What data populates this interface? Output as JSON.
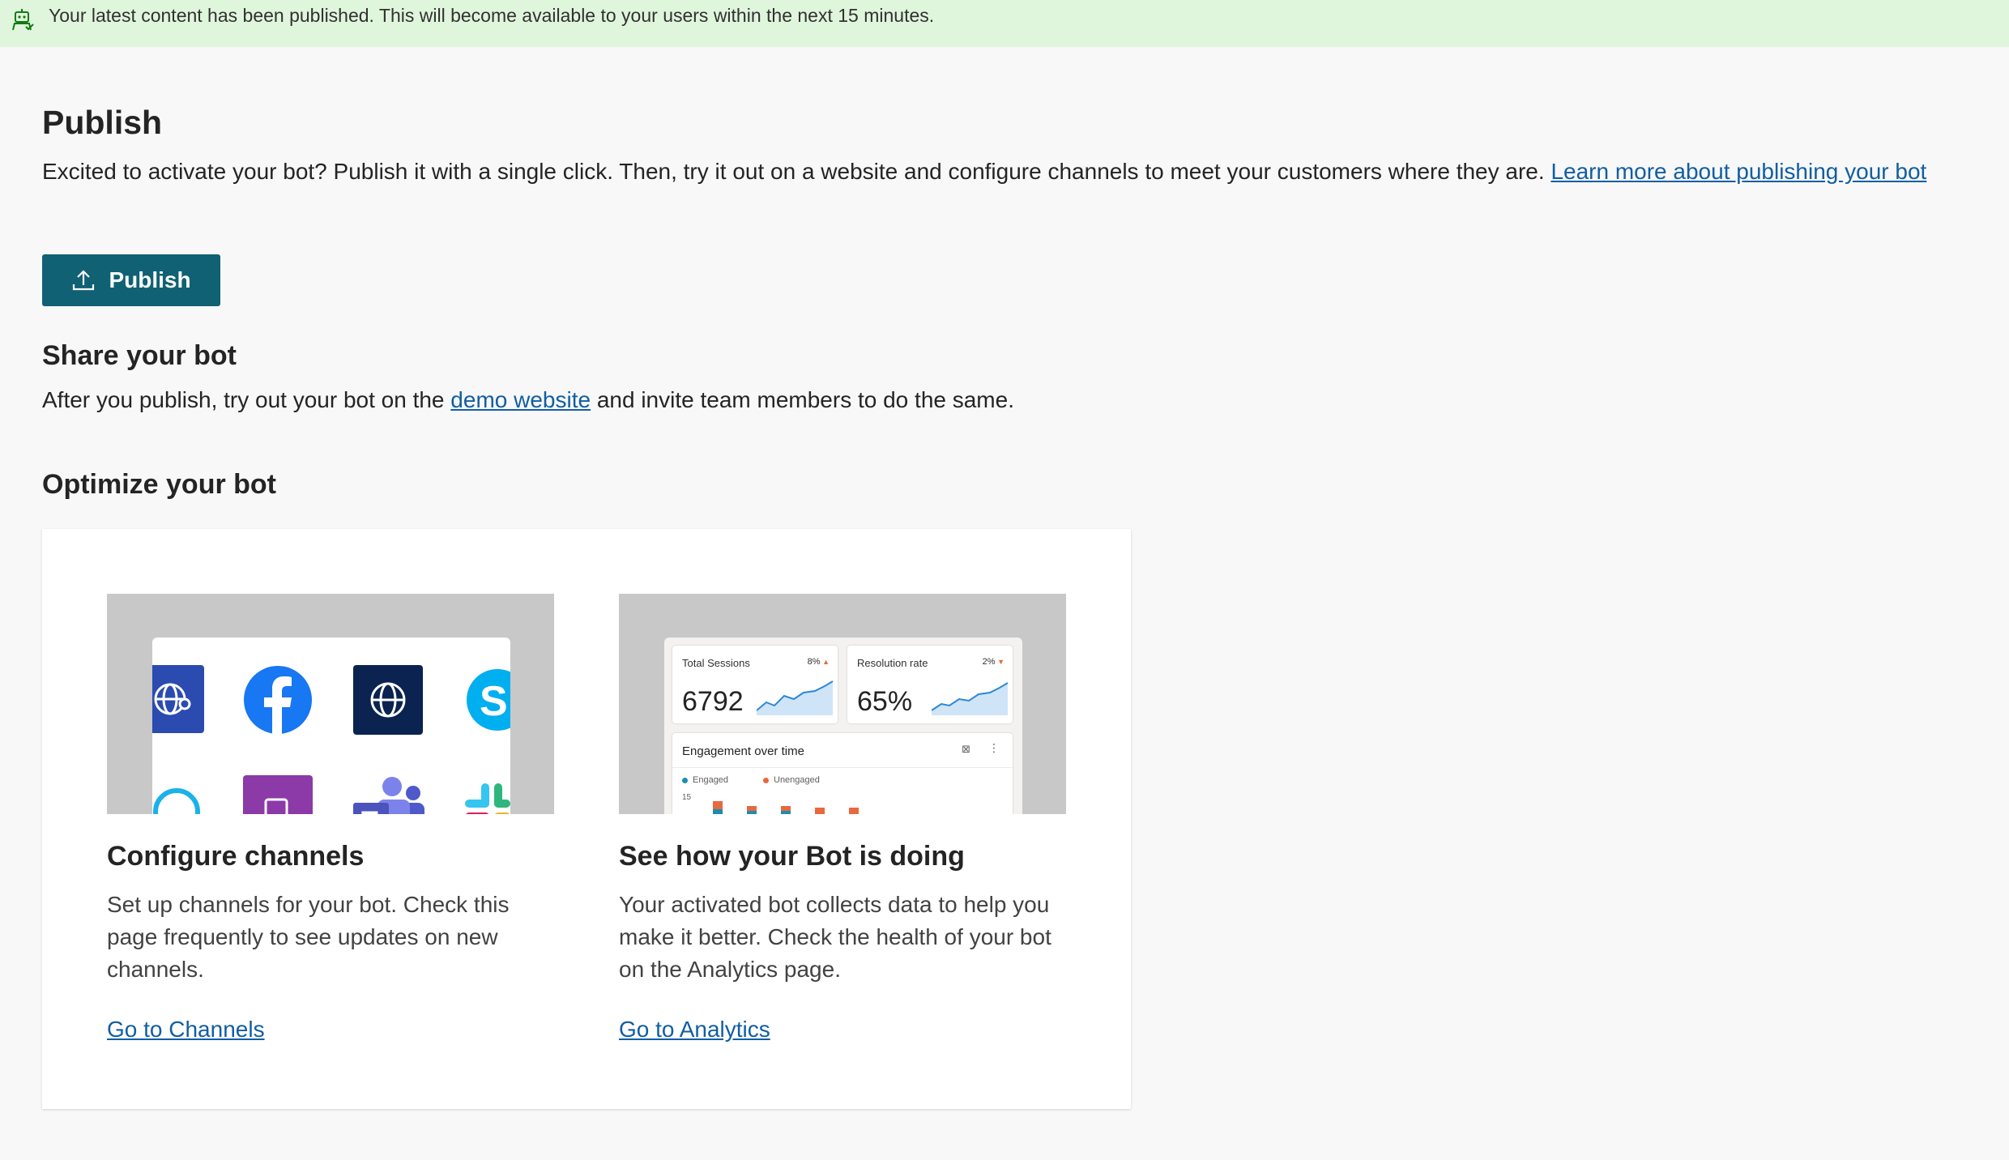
{
  "banner": {
    "message": "Your latest content has been published. This will become available to your users within the next 15 minutes.",
    "icon": "bot-icon"
  },
  "publish_section": {
    "title": "Publish",
    "intro": "Excited to activate your bot? Publish it with a single click. Then, try it out on a website and configure channels to meet your customers where they are. ",
    "learn_more_link": "Learn more about publishing your bot",
    "button_label": "Publish",
    "button_icon": "upload-icon"
  },
  "share_section": {
    "title": "Share your bot",
    "text_before": "After you publish, try out your bot on the ",
    "link": "demo website",
    "text_after": " and invite team members to do the same."
  },
  "optimize_section": {
    "title": "Optimize your bot",
    "cards": [
      {
        "title": "Configure channels",
        "description": "Set up channels for your bot. Check this page frequently to see updates on new channels.",
        "link": "Go to Channels"
      },
      {
        "title": "See how your Bot is doing",
        "description": "Your activated bot collects data to help you make it better. Check the health of your bot on the Analytics page.",
        "link": "Go to Analytics"
      }
    ]
  },
  "analytics_preview": {
    "total_sessions_label": "Total Sessions",
    "total_sessions_delta": "8%",
    "total_sessions_value": "6792",
    "resolution_label": "Resolution rate",
    "resolution_delta": "2%",
    "resolution_value": "65%",
    "engagement_title": "Engagement over time",
    "legend_engaged": "Engaged",
    "legend_unengaged": "Unengaged",
    "y_tick": "15"
  },
  "colors": {
    "banner_bg": "#dff6dd",
    "primary_button": "#0f6173",
    "link": "#115ea3",
    "engaged": "#1b8eb0",
    "unengaged": "#e8693d"
  }
}
